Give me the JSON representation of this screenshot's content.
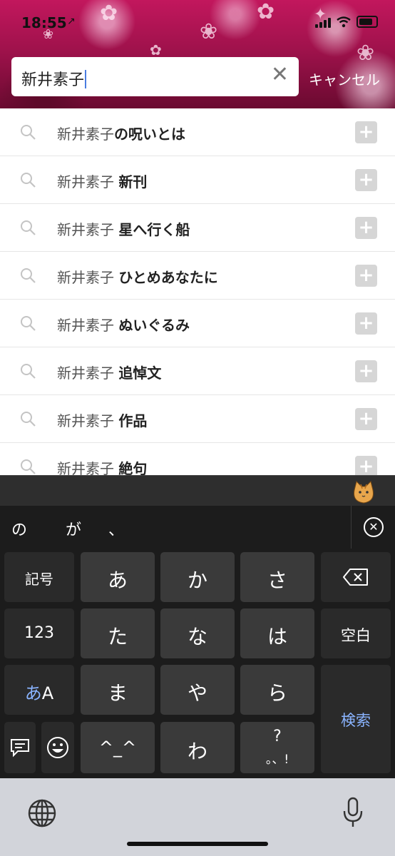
{
  "status_bar": {
    "time": "18:55",
    "location_arrow": "↗"
  },
  "search": {
    "value": "新井素子",
    "clear_icon": "✕",
    "cancel_label": "キャンセル"
  },
  "suggestions": [
    {
      "prefix": "新井素子",
      "suffix": "の呪いとは"
    },
    {
      "prefix": "新井素子 ",
      "suffix": "新刊"
    },
    {
      "prefix": "新井素子 ",
      "suffix": "星へ行く船"
    },
    {
      "prefix": "新井素子 ",
      "suffix": "ひとめあなたに"
    },
    {
      "prefix": "新井素子 ",
      "suffix": "ぬいぐるみ"
    },
    {
      "prefix": "新井素子 ",
      "suffix": "追悼文"
    },
    {
      "prefix": "新井素子 ",
      "suffix": "作品"
    },
    {
      "prefix": "新井素子 ",
      "suffix": "絶句"
    }
  ],
  "suggestion_add_label": "+",
  "candidates": [
    "の",
    "が",
    "、"
  ],
  "keyboard": {
    "symbols": "記号",
    "row1": [
      "あ",
      "か",
      "さ"
    ],
    "row2": [
      "た",
      "な",
      "は"
    ],
    "row3": [
      "ま",
      "や",
      "ら"
    ],
    "row4_face": "^_^",
    "row4_wa": "わ",
    "row4_punct_top": "?",
    "row4_punct_bottom": "。、!",
    "numbers": "123",
    "space": "空白",
    "mode_a": "あ",
    "mode_b": "A",
    "search": "検索"
  },
  "colors": {
    "accent_search": "#4a7de0",
    "header_pink": "#c2175d"
  }
}
